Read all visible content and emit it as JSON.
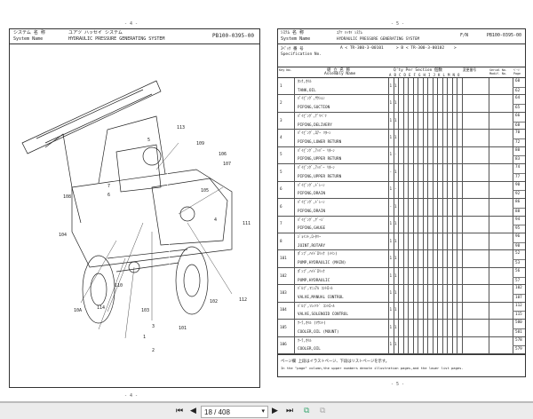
{
  "left_page": {
    "page_marker": "- 4 -",
    "system_label_jp": "システム 名 称",
    "system_label_en": "System Name",
    "system_name_jp": "ユアツ ハッセイ システム",
    "system_name_en": "HYDRAULIC PRESSURE GENERATING SYSTEM",
    "doc_no": "PB100-0395-00",
    "bottom_marker": "- 4 -",
    "callouts": [
      "113",
      "5",
      "109",
      "106",
      "107",
      "105",
      "111",
      "108",
      "7",
      "104",
      "102",
      "1",
      "2",
      "3",
      "110",
      "114",
      "103",
      "101",
      "10A",
      "112",
      "4",
      "6"
    ]
  },
  "right_page": {
    "page_marker": "- 5 -",
    "system_label_jp": "ｼｽﾃﾑ 名 称",
    "system_label_en": "System Name",
    "system_name_jp": "ﾕｱﾂ ﾊｯｾｲ ｼｽﾃﾑ",
    "system_name_en": "HYDRAULIC PRESSURE GENERATING SYSTEM",
    "file_label": "F/N",
    "doc_no": "PB100-0395-00",
    "spec_label_jp": "ｽﾍﾟｯｸ 番 号",
    "spec_label_en": "Specification No.",
    "spec_a": "A < TR-300-3-00101",
    "spec_b": "> B < TR-300-3-00102",
    "spec_end": ">",
    "col_key": "Key No.",
    "col_assembly_jp": "組 立 名 称",
    "col_assembly_en": "Assembly Name",
    "col_qty": "Q'ty Per Section 個数",
    "qty_letters": [
      "A",
      "B",
      "C",
      "D",
      "E",
      "F",
      "G",
      "H",
      "I",
      "J",
      "K",
      "L",
      "M",
      "N",
      "O"
    ],
    "col_change": "変更番号",
    "col_serial": "Serial No. Modif. No.",
    "col_page": "ﾍﾟｰｼﾞ Page",
    "rows": [
      {
        "key": "1",
        "jp": "ﾀﾝｸ,ｵｲﾙ",
        "en": "TANK,OIL",
        "qa": "1",
        "qb": "1",
        "p1": "60",
        "p2": "62"
      },
      {
        "key": "2",
        "jp": "ﾊﾟｲﾋﾟﾝｸﾞ,ｻｸｼｮﾝ",
        "en": "PIPING,SUCTION",
        "qa": "1",
        "qb": "1",
        "p1": "64",
        "p2": "65"
      },
      {
        "key": "3",
        "jp": "ﾊﾟｲﾋﾟﾝｸﾞ,ﾃﾞﾘﾍﾞﾘ",
        "en": "PIPING,DELIVERY",
        "qa": "1",
        "qb": "1",
        "p1": "66",
        "p2": "68"
      },
      {
        "key": "4",
        "jp": "ﾊﾟｲﾋﾟﾝｸﾞ,ﾛｱｰ ﾘﾀｰﾝ",
        "en": "PIPING,LOWER RETURN",
        "qa": "1",
        "qb": "1",
        "p1": "70",
        "p2": "72"
      },
      {
        "key": "5",
        "jp": "ﾊﾟｲﾋﾟﾝｸﾞ,ｱｯﾊﾟｰ ﾘﾀｰﾝ",
        "en": "PIPING,UPPER RETURN",
        "qa": "1",
        "qb": "-",
        "p1": "80",
        "p2": "83"
      },
      {
        "key": "5",
        "jp": "ﾊﾟｲﾋﾟﾝｸﾞ,ｱｯﾊﾟｰ ﾘﾀｰﾝ",
        "en": "PIPING,UPPER RETURN",
        "qa": "-",
        "qb": "1",
        "p1": "74",
        "p2": "77"
      },
      {
        "key": "6",
        "jp": "ﾊﾟｲﾋﾟﾝｸﾞ,ﾄﾞﾚｰﾝ",
        "en": "PIPING,DRAIN",
        "qa": "1",
        "qb": "-",
        "p1": "90",
        "p2": "92"
      },
      {
        "key": "6",
        "jp": "ﾊﾟｲﾋﾟﾝｸﾞ,ﾄﾞﾚｰﾝ",
        "en": "PIPING,DRAIN",
        "qa": "-",
        "qb": "1",
        "p1": "86",
        "p2": "88"
      },
      {
        "key": "7",
        "jp": "ﾊﾟｲﾋﾟﾝｸﾞ,ｹﾞｰｼﾞ",
        "en": "PIPING,GAUGE",
        "qa": "1",
        "qb": "1",
        "p1": "94",
        "p2": "95"
      },
      {
        "key": "8",
        "jp": "ｼﾞｮｲﾝﾄ,ﾛｰﾀﾘｰ",
        "en": "JOINT,ROTARY",
        "qa": "1",
        "qb": "1",
        "p1": "96",
        "p2": "98"
      },
      {
        "key": "101",
        "jp": "ﾎﾟﾝﾌﾟ,ﾊｲﾄﾞﾛﾘｯｸ (ﾒｲﾝ)",
        "en": "PUMP,HYDRAULIC (MAIN)",
        "qa": "1",
        "qb": "1",
        "p1": "52",
        "p2": "53"
      },
      {
        "key": "102",
        "jp": "ﾎﾟﾝﾌﾟ,ﾊｲﾄﾞﾛﾘｯｸ",
        "en": "PUMP,HYDRAULIC",
        "qa": "1",
        "qb": "1",
        "p1": "56",
        "p2": "57"
      },
      {
        "key": "103",
        "jp": "ﾊﾞﾙﾌﾞ,ﾏﾆｭｱﾙ ｺﾝﾄﾛｰﾙ",
        "en": "VALVE,MANUAL CONTROL",
        "qa": "1",
        "qb": "1",
        "p1": "102",
        "p2": "107"
      },
      {
        "key": "104",
        "jp": "ﾊﾞﾙﾌﾞ,ｿﾚﾉｲﾄﾞ ｺﾝﾄﾛｰﾙ",
        "en": "VALVE,SOLENOID CONTROL",
        "qa": "1",
        "qb": "1",
        "p1": "112",
        "p2": "115"
      },
      {
        "key": "105",
        "jp": "ｸｰﾗ,ｵｲﾙ (ﾏｳﾝﾄ)",
        "en": "COOLER,OIL (MOUNT)",
        "qa": "1",
        "qb": "1",
        "p1": "580",
        "p2": "581"
      },
      {
        "key": "106",
        "jp": "ｸｰﾗ,ｵｲﾙ",
        "en": "COOLER,OIL",
        "qa": "1",
        "qb": "1",
        "p1": "578",
        "p2": "579"
      }
    ],
    "note_jp": "ページ欄 上段はイラストページ、下段はリストページを示す。",
    "note_en": "In the \"page\" column,the upper numbers denote illustration pages,and the lower list pages.",
    "bottom_marker": "- 5 -"
  },
  "toolbar": {
    "page_value": "18 / 408"
  }
}
